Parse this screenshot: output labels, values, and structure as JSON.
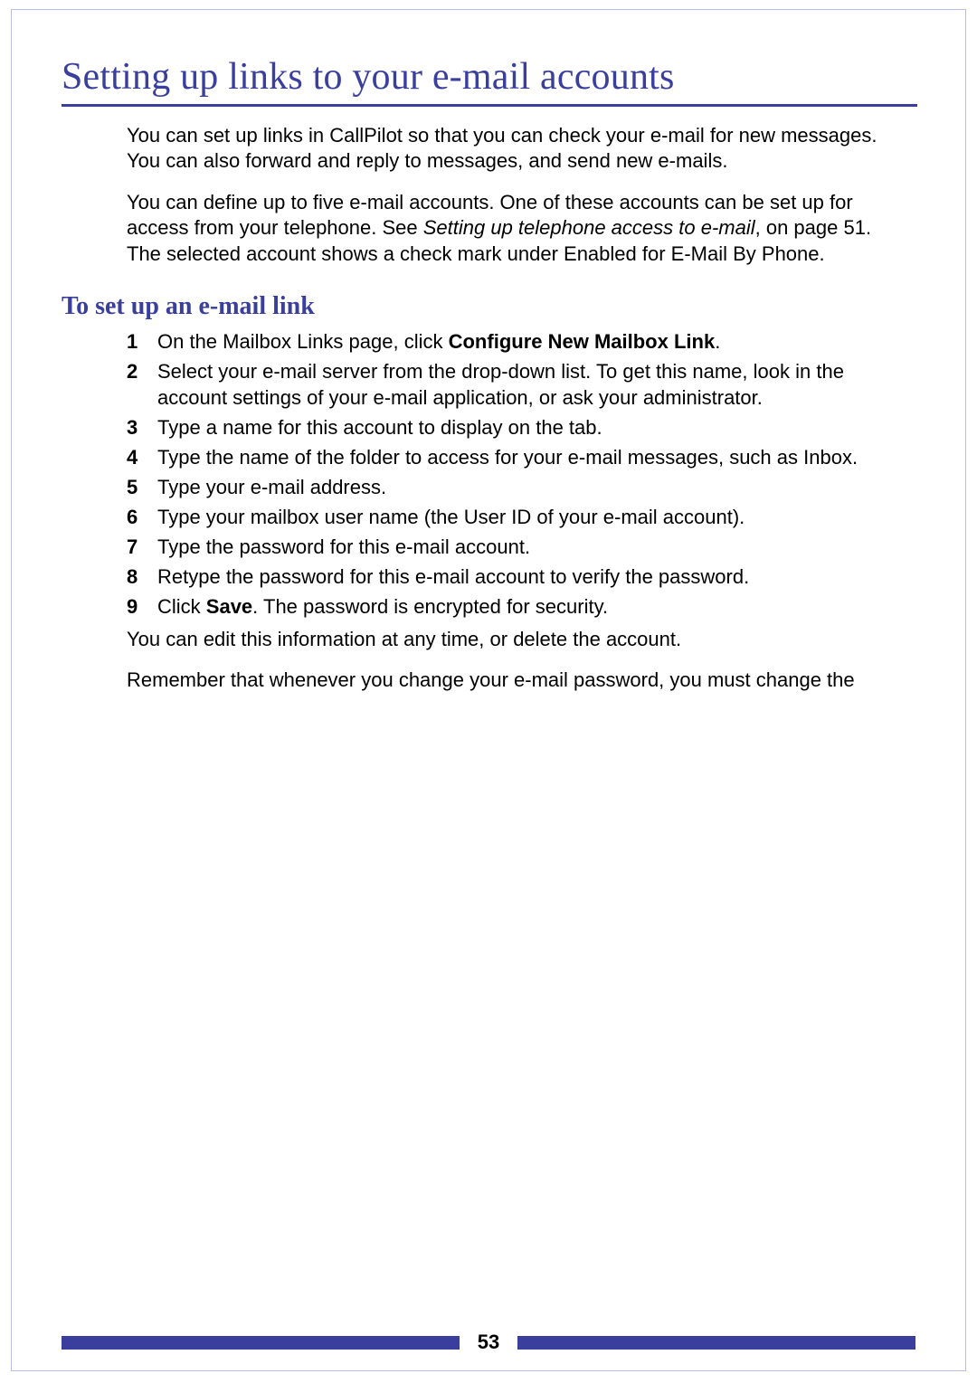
{
  "title": "Setting up links to your e-mail accounts",
  "intro": {
    "p1": "You can set up links in CallPilot so that you can check your e-mail for new messages. You can also forward and reply to messages, and send new e-mails.",
    "p2a": "You can define up to five e-mail accounts. One of these accounts can be set up for access from your telephone. See ",
    "p2_italic": "Setting up telephone access to e-mail",
    "p2b": ", on page 51. The selected account shows a check mark under Enabled for E-Mail By Phone."
  },
  "subhead": "To set up an e-mail link",
  "steps": [
    {
      "n": "1",
      "pre": "On the Mailbox Links page, click ",
      "bold": "Configure New Mailbox Link",
      "post": "."
    },
    {
      "n": "2",
      "text": "Select your e-mail server from the drop-down list. To get this name, look in the account settings of your e-mail application, or ask your administrator."
    },
    {
      "n": "3",
      "text": "Type a name for this account to display on the tab."
    },
    {
      "n": "4",
      "text": "Type the name of the folder to access for your e-mail messages, such as Inbox."
    },
    {
      "n": "5",
      "text": "Type your e-mail address."
    },
    {
      "n": "6",
      "text": "Type your mailbox user name (the User ID of your e-mail account)."
    },
    {
      "n": "7",
      "text": "Type the password for this e-mail account."
    },
    {
      "n": "8",
      "text": "Retype the password for this e-mail account to verify the password."
    },
    {
      "n": "9",
      "pre": "Click ",
      "bold": "Save",
      "post": ". The password is encrypted for security."
    }
  ],
  "after": {
    "p1": "You can edit this information at any time, or delete the account.",
    "p2": "Remember that whenever you change your e-mail password, you must change the"
  },
  "page_number": "53"
}
